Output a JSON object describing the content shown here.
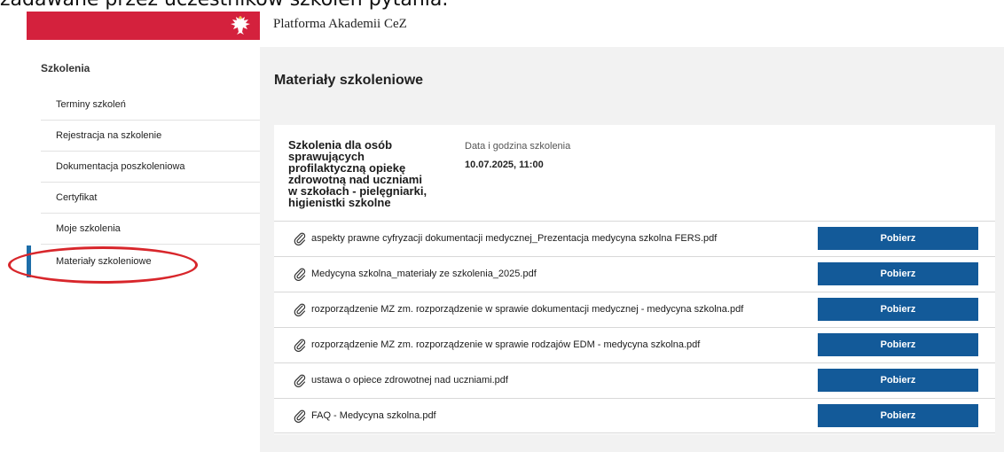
{
  "caption": "zadawane przez uczestników szkoleń pytania.",
  "header": {
    "title": "Platforma Akademii CeZ",
    "logo_icon": "polish-eagle-icon",
    "brand_color": "#d4213d"
  },
  "sidebar": {
    "heading": "Szkolenia",
    "items": [
      {
        "label": "Terminy szkoleń"
      },
      {
        "label": "Rejestracja na szkolenie"
      },
      {
        "label": "Dokumentacja poszkoleniowa"
      },
      {
        "label": "Certyfikat"
      },
      {
        "label": "Moje szkolenia"
      },
      {
        "label": "Materiały szkoleniowe",
        "active": true
      }
    ]
  },
  "main": {
    "title": "Materiały szkoleniowe",
    "course": {
      "name": "Szkolenia dla osób sprawujących profilaktyczną opiekę zdrowotną nad uczniami w szkołach - pielęgniarki, higienistki szkolne",
      "date_label": "Data i godzina szkolenia",
      "date_value": "10.07.2025, 11:00"
    },
    "files": [
      {
        "name": "aspekty prawne cyfryzacji dokumentacji medycznej_Prezentacja medycyna szkolna FERS.pdf",
        "button": "Pobierz"
      },
      {
        "name": "Medycyna szkolna_materiały ze szkolenia_2025.pdf",
        "button": "Pobierz"
      },
      {
        "name": "rozporządzenie MZ zm. rozporządzenie w sprawie dokumentacji medycznej - medycyna szkolna.pdf",
        "button": "Pobierz"
      },
      {
        "name": "rozporządzenie MZ zm. rozporządzenie w sprawie rodzajów EDM - medycyna szkolna.pdf",
        "button": "Pobierz"
      },
      {
        "name": "ustawa o opiece zdrowotnej nad uczniami.pdf",
        "button": "Pobierz"
      },
      {
        "name": "FAQ - Medycyna szkolna.pdf",
        "button": "Pobierz"
      }
    ],
    "button_color": "#135a99"
  },
  "annotation": {
    "color": "#d8262b"
  }
}
